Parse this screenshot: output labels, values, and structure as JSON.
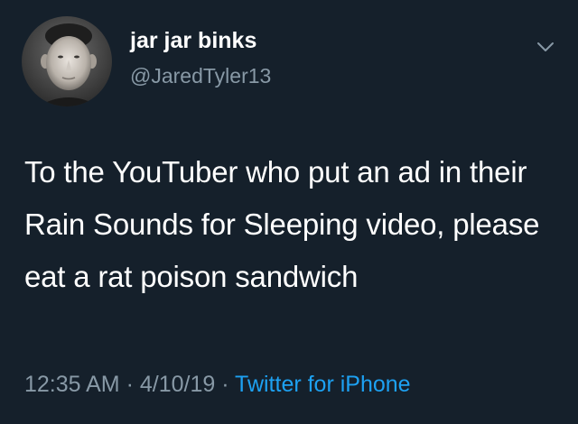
{
  "user": {
    "display_name": "jar jar binks",
    "handle": "@JaredTyler13",
    "avatar_icon": "profile-photo"
  },
  "menu": {
    "icon": "chevron-down-icon"
  },
  "tweet": {
    "text": "To the YouTuber who put an ad in their Rain Sounds for Sleeping video, please eat a rat poison sandwich"
  },
  "meta": {
    "time": "12:35 AM",
    "separator_1": " · ",
    "date": "4/10/19",
    "separator_2": " · ",
    "source": "Twitter for iPhone"
  },
  "colors": {
    "background": "#15202b",
    "primary_text": "#ffffff",
    "secondary_text": "#8899a6",
    "link": "#1da1f2"
  }
}
